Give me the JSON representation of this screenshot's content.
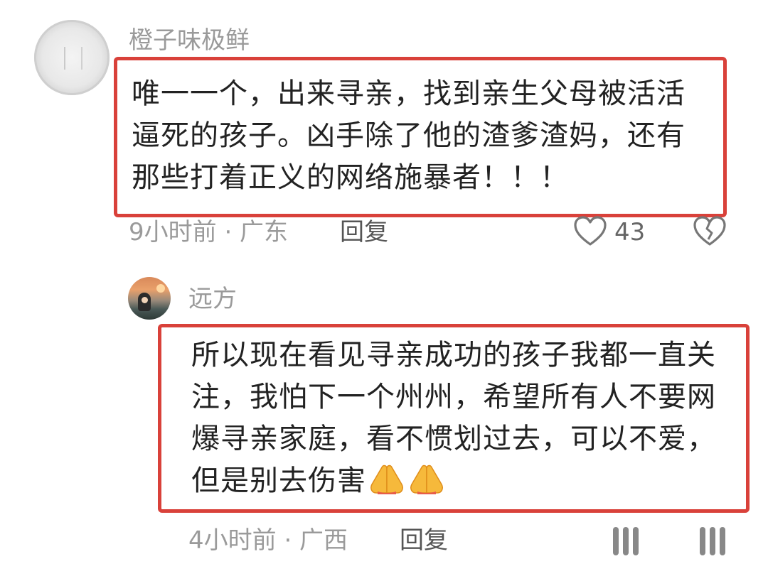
{
  "comments": [
    {
      "username": "橙子味极鲜",
      "text": "唯一一个，出来寻亲，找到亲生父母被活活逼死的孩子。凶手除了他的渣爹渣妈，还有那些打着正义的网络施暴者！！！",
      "meta": "9小时前 · 广东",
      "reply_label": "回复",
      "like_count": "43",
      "avatar_icon": "blurred-gray-avatar",
      "like_icon": "heart-outline-icon",
      "dislike_icon": "broken-heart-icon"
    },
    {
      "username": "远方",
      "text": "所以现在看见寻亲成功的孩子我都一直关注，我怕下一个州州，希望所有人不要网爆寻亲家庭，看不惯划过去，可以不爱，但是别去伤害",
      "emoji": [
        "folded-hands-emoji",
        "folded-hands-emoji"
      ],
      "meta": "4小时前 · 广西",
      "reply_label": "回复",
      "avatar_icon": "sunset-illustration-avatar"
    }
  ],
  "colors": {
    "highlight_border": "#d9413a",
    "meta_gray": "#9a9a9a",
    "text": "#222222"
  }
}
